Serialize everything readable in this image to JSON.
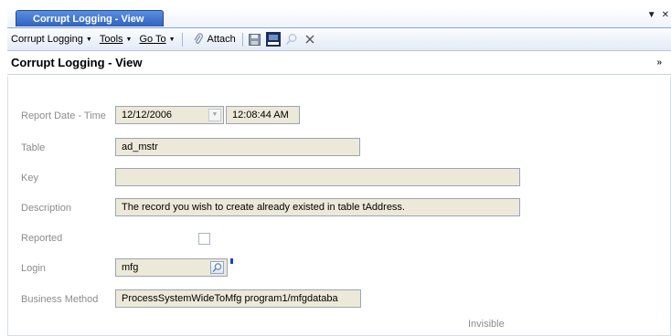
{
  "tab": {
    "title": "Corrupt Logging - View"
  },
  "toolbar": {
    "menu_label": "Corrupt Logging",
    "tools_label": "Tools",
    "goto_label": "Go To",
    "attach_label": "Attach"
  },
  "form": {
    "title": "Corrupt Logging - View",
    "fields": {
      "report_date_label": "Report Date - Time",
      "report_date_value": "12/12/2006",
      "report_time_value": "12:08:44 AM",
      "table_label": "Table",
      "table_value": "ad_mstr",
      "key_label": "Key",
      "key_value": "",
      "description_label": "Description",
      "description_value": "The record you wish to create already existed in table tAddress.",
      "reported_label": "Reported",
      "reported_checked": false,
      "login_label": "Login",
      "login_value": "mfg",
      "business_method_label": "Business Method",
      "business_method_value": "ProcessSystemWideToMfg  program1/mfgdataba"
    },
    "status_text": "Invisible"
  },
  "colors": {
    "tab_active": "#2f63bf",
    "field_bg": "#ece9d8",
    "label_gray": "#8c8c8c",
    "marker_blue": "#1d3fd1"
  }
}
